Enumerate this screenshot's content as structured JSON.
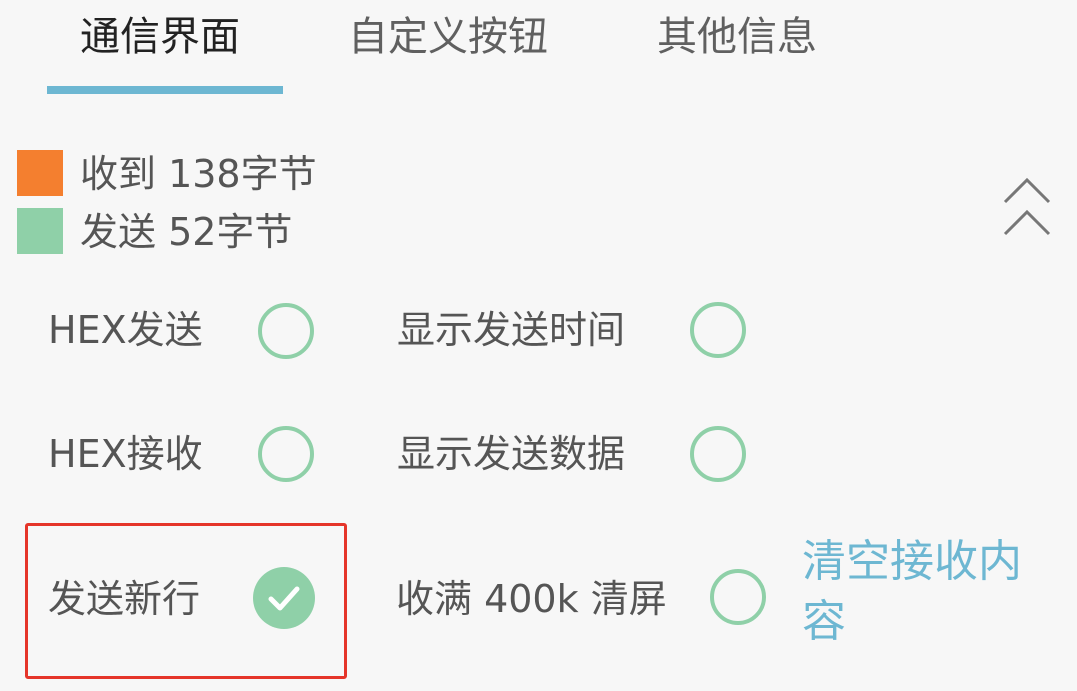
{
  "tabs": [
    {
      "label": "通信界面",
      "active": true
    },
    {
      "label": "自定义按钮",
      "active": false
    },
    {
      "label": "其他信息",
      "active": false
    }
  ],
  "stats": {
    "received_label": "收到 138字节",
    "received_color": "#f47f2f",
    "sent_label": "发送 52字节",
    "sent_color": "#8fd0a8"
  },
  "collapse_icon": "double-chevron-up-icon",
  "options": {
    "hex_send": {
      "label": "HEX发送",
      "checked": false
    },
    "show_send_time": {
      "label": "显示发送时间",
      "checked": false
    },
    "hex_receive": {
      "label": "HEX接收",
      "checked": false
    },
    "show_send_data": {
      "label": "显示发送数据",
      "checked": false
    },
    "send_newline": {
      "label": "发送新行",
      "checked": true
    },
    "clear_when_full": {
      "label": "收满 400k 清屏",
      "checked": false
    }
  },
  "clear_button": {
    "label": "清空接收内容"
  },
  "colors": {
    "accent": "#6db7d2",
    "radio": "#8fd0a8",
    "highlight": "#e5352a"
  }
}
